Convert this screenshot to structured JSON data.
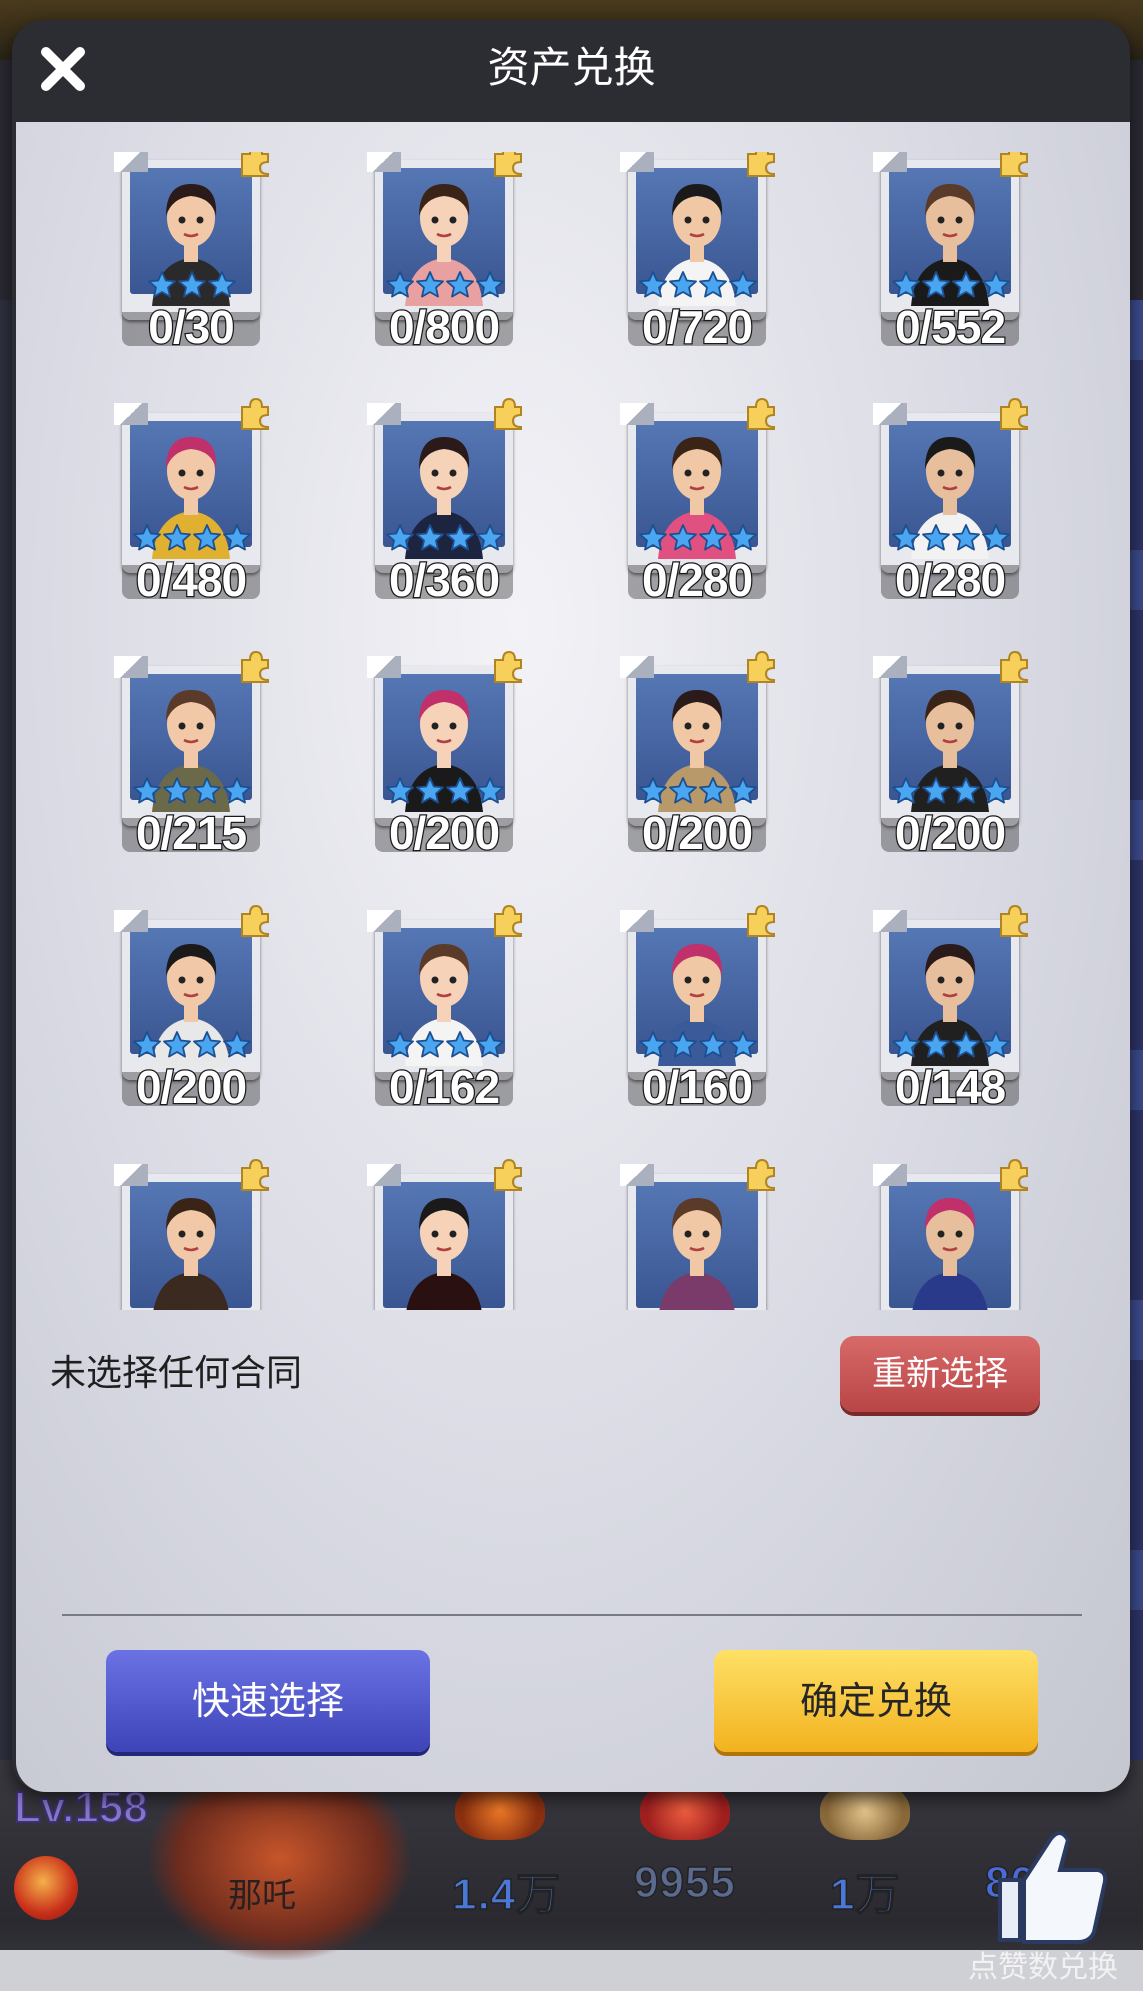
{
  "dialog": {
    "title": "资产兑换",
    "status_text": "未选择任何合同",
    "reselect_label": "重新选择",
    "quick_select_label": "快速选择",
    "confirm_label": "确定兑换"
  },
  "cards": [
    {
      "count": "0/30",
      "stars": 3
    },
    {
      "count": "0/800",
      "stars": 4
    },
    {
      "count": "0/720",
      "stars": 4
    },
    {
      "count": "0/552",
      "stars": 4
    },
    {
      "count": "0/480",
      "stars": 4
    },
    {
      "count": "0/360",
      "stars": 4
    },
    {
      "count": "0/280",
      "stars": 4
    },
    {
      "count": "0/280",
      "stars": 4
    },
    {
      "count": "0/215",
      "stars": 4
    },
    {
      "count": "0/200",
      "stars": 4
    },
    {
      "count": "0/200",
      "stars": 4
    },
    {
      "count": "0/200",
      "stars": 4
    },
    {
      "count": "0/200",
      "stars": 4
    },
    {
      "count": "0/162",
      "stars": 4
    },
    {
      "count": "0/160",
      "stars": 4
    },
    {
      "count": "0/148",
      "stars": 4
    },
    {
      "count": "",
      "stars": 0
    },
    {
      "count": "",
      "stars": 0
    },
    {
      "count": "",
      "stars": 0
    },
    {
      "count": "",
      "stars": 0
    }
  ],
  "hud": {
    "level": "Lv.158",
    "hero_name": "那吒",
    "resources": [
      "1.4万",
      "9955",
      "1万",
      "80"
    ],
    "like_label": "点赞数兑换"
  },
  "colors": {
    "card_bg": "#4a69a8",
    "star_blue": "#4aa6f0",
    "quick_button": "#4a52c8",
    "confirm_button": "#f7c63a",
    "reselect_button": "#c65050"
  }
}
